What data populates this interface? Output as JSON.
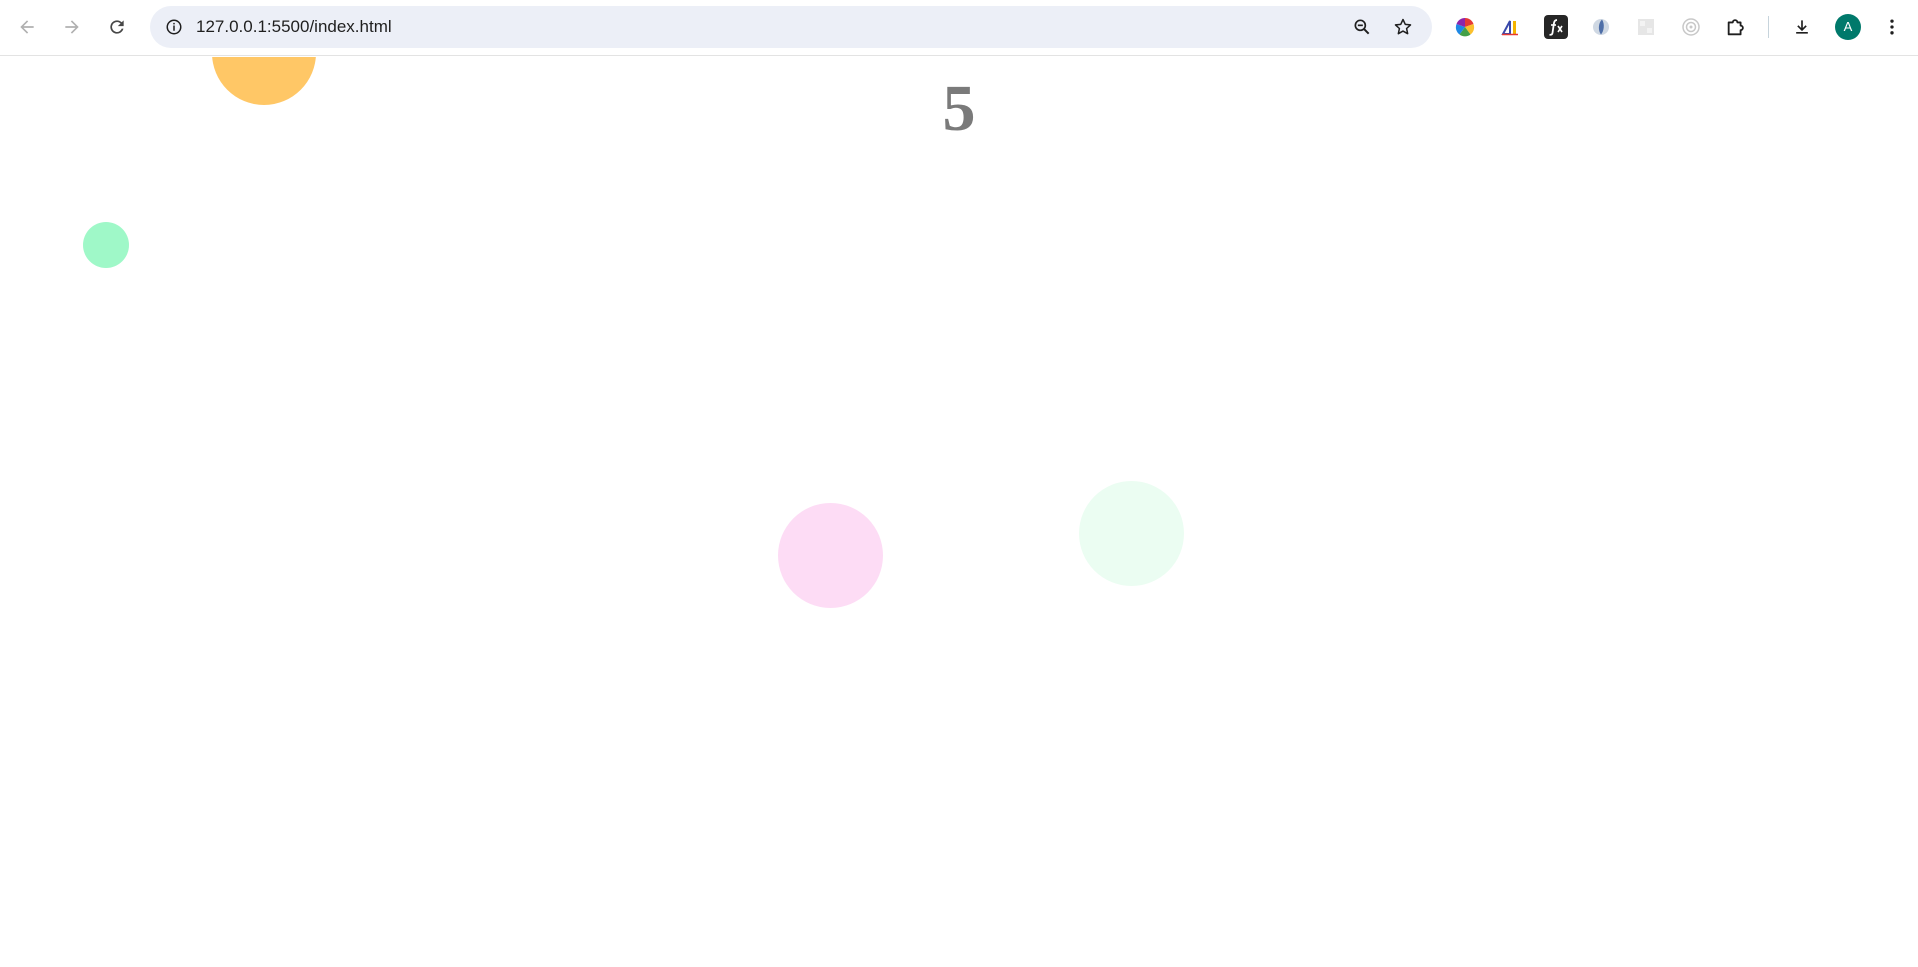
{
  "browser": {
    "url": "127.0.0.1:5500/index.html",
    "avatar_letter": "A",
    "icons": {
      "back": "arrow-left-icon",
      "forward": "arrow-right-icon",
      "reload": "reload-icon",
      "site_info": "info-icon",
      "zoom": "zoom-out-icon",
      "bookmark": "star-icon",
      "extensions": [
        "color-wheel-extension-icon",
        "ruler-extension-icon",
        "fx-extension-icon",
        "globe-extension-icon",
        "grid-extension-icon",
        "target-extension-icon",
        "puzzle-icon"
      ],
      "downloads": "download-icon",
      "menu": "kebab-menu-icon"
    }
  },
  "game": {
    "score": "5",
    "bubbles": [
      {
        "color": "#ffc766"
      },
      {
        "color": "#9ff8c8"
      },
      {
        "color": "#fddcf5"
      },
      {
        "color": "#ebfdf2"
      }
    ]
  }
}
